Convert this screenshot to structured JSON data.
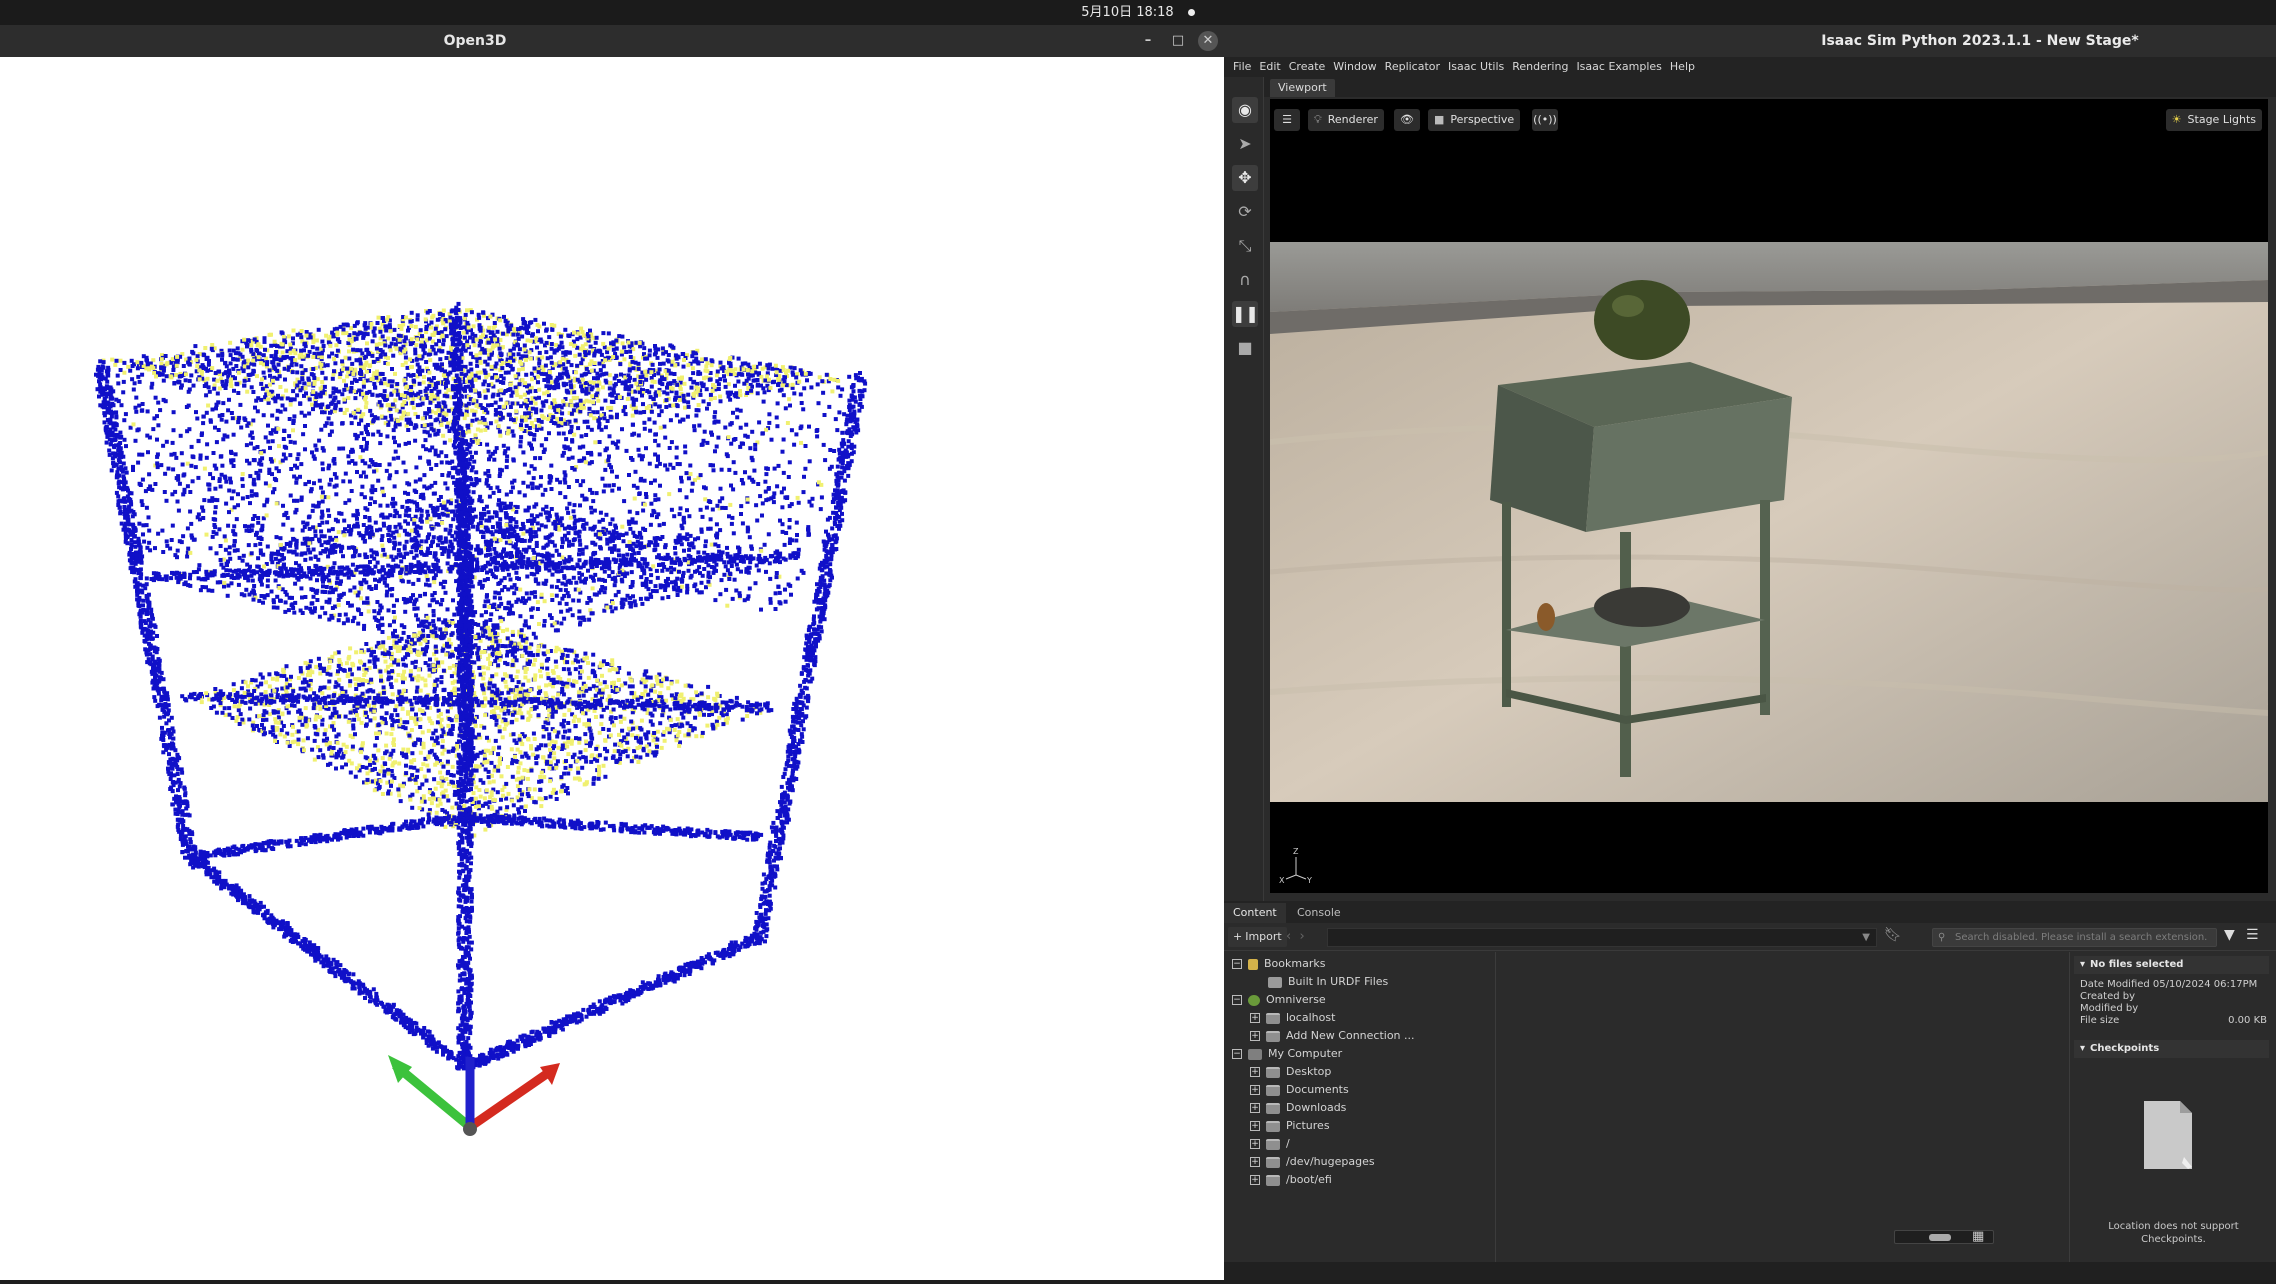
{
  "system": {
    "datetime": "5月10日  18:18"
  },
  "open3d": {
    "title": "Open3D",
    "minimize_glyph": "–",
    "maximize_glyph": "□",
    "close_glyph": "✕"
  },
  "isaac": {
    "title": "Isaac Sim Python 2023.1.1 - New Stage*",
    "menu": [
      "File",
      "Edit",
      "Create",
      "Window",
      "Replicator",
      "Isaac Utils",
      "Rendering",
      "Isaac Examples",
      "Help"
    ],
    "viewport": {
      "tab": "Viewport",
      "renderer_label": "Renderer",
      "perspective_label": "Perspective",
      "stage_lights_label": "Stage Lights",
      "axis_labels": {
        "z": "Z",
        "x": "X",
        "y": "Y"
      }
    },
    "tools": [
      "select-icon",
      "arrow-icon",
      "move-icon",
      "rotate-icon",
      "scale-icon",
      "snap-icon",
      "pause-icon",
      "stop-icon"
    ],
    "bottom": {
      "tabs": [
        "Content",
        "Console"
      ],
      "import_label": "Import",
      "search_placeholder": "Search disabled. Please install a search extension.",
      "tree": {
        "bookmarks": "Bookmarks",
        "built_in_urdf": "Built In URDF Files",
        "omniverse": "Omniverse",
        "localhost": "localhost",
        "add_connection": "Add New Connection ...",
        "my_computer": "My Computer",
        "desktop": "Desktop",
        "documents": "Documents",
        "downloads": "Downloads",
        "pictures": "Pictures",
        "root": "/",
        "hugepages": "/dev/hugepages",
        "boot_efi": "/boot/efi"
      },
      "details": {
        "header": "No files selected",
        "date_modified": "Date Modified 05/10/2024 06:17PM",
        "created_by": "Created by",
        "modified_by": "Modified by",
        "file_size_label": "File size",
        "file_size_value": "0.00 KB",
        "checkpoints_header": "Checkpoints",
        "checkpoints_msg": "Location does not support Checkpoints."
      }
    }
  },
  "colors": {
    "point_primary": "#1010c8",
    "point_highlight": "#f0f070",
    "axis_x": "#d42a1f",
    "axis_y": "#3cc23c",
    "axis_z": "#2020cc"
  }
}
